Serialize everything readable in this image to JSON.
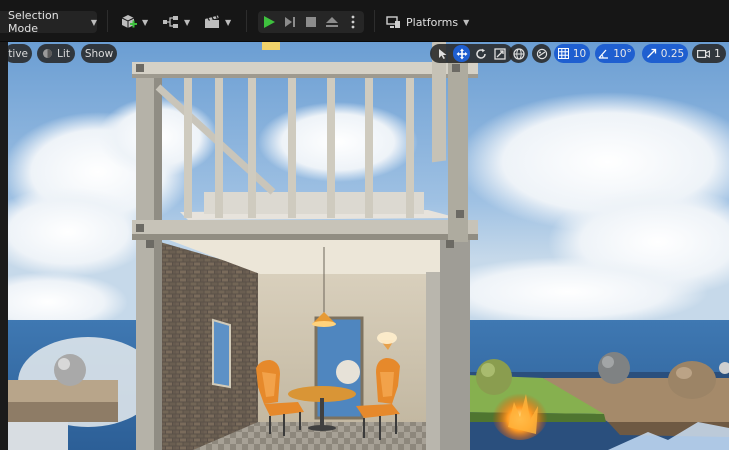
{
  "toolbar": {
    "mode_label": "Selection Mode",
    "platforms_label": "Platforms"
  },
  "viewport": {
    "view_mode_label": "tive",
    "lit_label": "Lit",
    "show_label": "Show",
    "grid_snap_value": "10",
    "rotation_snap_value": "10°",
    "scale_snap_value": "0.25",
    "camera_speed_value": "1"
  },
  "colors": {
    "accent": "#1f5fd0",
    "play_green": "#3ec13e",
    "toolbar_bg": "#161616"
  },
  "icons": [
    "chevron-down-icon",
    "add-content-icon",
    "blueprint-icon",
    "cinematics-icon",
    "play-icon",
    "step-icon",
    "stop-icon",
    "eject-icon",
    "more-options-icon",
    "platforms-icon",
    "select-icon",
    "translate-icon",
    "rotate-icon",
    "scale-icon",
    "world-space-icon",
    "surface-snap-icon",
    "grid-snap-icon",
    "rotation-snap-icon",
    "scale-snap-icon",
    "camera-speed-icon"
  ]
}
